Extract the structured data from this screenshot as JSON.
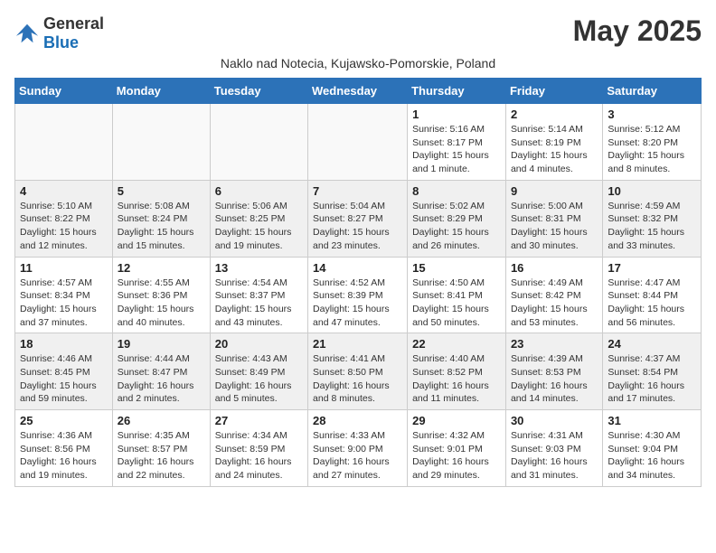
{
  "header": {
    "logo_general": "General",
    "logo_blue": "Blue",
    "title": "May 2025",
    "subtitle": "Naklo nad Notecia, Kujawsko-Pomorskie, Poland"
  },
  "days_of_week": [
    "Sunday",
    "Monday",
    "Tuesday",
    "Wednesday",
    "Thursday",
    "Friday",
    "Saturday"
  ],
  "weeks": [
    [
      {
        "day": "",
        "info": ""
      },
      {
        "day": "",
        "info": ""
      },
      {
        "day": "",
        "info": ""
      },
      {
        "day": "",
        "info": ""
      },
      {
        "day": "1",
        "info": "Sunrise: 5:16 AM\nSunset: 8:17 PM\nDaylight: 15 hours and 1 minute."
      },
      {
        "day": "2",
        "info": "Sunrise: 5:14 AM\nSunset: 8:19 PM\nDaylight: 15 hours and 4 minutes."
      },
      {
        "day": "3",
        "info": "Sunrise: 5:12 AM\nSunset: 8:20 PM\nDaylight: 15 hours and 8 minutes."
      }
    ],
    [
      {
        "day": "4",
        "info": "Sunrise: 5:10 AM\nSunset: 8:22 PM\nDaylight: 15 hours and 12 minutes."
      },
      {
        "day": "5",
        "info": "Sunrise: 5:08 AM\nSunset: 8:24 PM\nDaylight: 15 hours and 15 minutes."
      },
      {
        "day": "6",
        "info": "Sunrise: 5:06 AM\nSunset: 8:25 PM\nDaylight: 15 hours and 19 minutes."
      },
      {
        "day": "7",
        "info": "Sunrise: 5:04 AM\nSunset: 8:27 PM\nDaylight: 15 hours and 23 minutes."
      },
      {
        "day": "8",
        "info": "Sunrise: 5:02 AM\nSunset: 8:29 PM\nDaylight: 15 hours and 26 minutes."
      },
      {
        "day": "9",
        "info": "Sunrise: 5:00 AM\nSunset: 8:31 PM\nDaylight: 15 hours and 30 minutes."
      },
      {
        "day": "10",
        "info": "Sunrise: 4:59 AM\nSunset: 8:32 PM\nDaylight: 15 hours and 33 minutes."
      }
    ],
    [
      {
        "day": "11",
        "info": "Sunrise: 4:57 AM\nSunset: 8:34 PM\nDaylight: 15 hours and 37 minutes."
      },
      {
        "day": "12",
        "info": "Sunrise: 4:55 AM\nSunset: 8:36 PM\nDaylight: 15 hours and 40 minutes."
      },
      {
        "day": "13",
        "info": "Sunrise: 4:54 AM\nSunset: 8:37 PM\nDaylight: 15 hours and 43 minutes."
      },
      {
        "day": "14",
        "info": "Sunrise: 4:52 AM\nSunset: 8:39 PM\nDaylight: 15 hours and 47 minutes."
      },
      {
        "day": "15",
        "info": "Sunrise: 4:50 AM\nSunset: 8:41 PM\nDaylight: 15 hours and 50 minutes."
      },
      {
        "day": "16",
        "info": "Sunrise: 4:49 AM\nSunset: 8:42 PM\nDaylight: 15 hours and 53 minutes."
      },
      {
        "day": "17",
        "info": "Sunrise: 4:47 AM\nSunset: 8:44 PM\nDaylight: 15 hours and 56 minutes."
      }
    ],
    [
      {
        "day": "18",
        "info": "Sunrise: 4:46 AM\nSunset: 8:45 PM\nDaylight: 15 hours and 59 minutes."
      },
      {
        "day": "19",
        "info": "Sunrise: 4:44 AM\nSunset: 8:47 PM\nDaylight: 16 hours and 2 minutes."
      },
      {
        "day": "20",
        "info": "Sunrise: 4:43 AM\nSunset: 8:49 PM\nDaylight: 16 hours and 5 minutes."
      },
      {
        "day": "21",
        "info": "Sunrise: 4:41 AM\nSunset: 8:50 PM\nDaylight: 16 hours and 8 minutes."
      },
      {
        "day": "22",
        "info": "Sunrise: 4:40 AM\nSunset: 8:52 PM\nDaylight: 16 hours and 11 minutes."
      },
      {
        "day": "23",
        "info": "Sunrise: 4:39 AM\nSunset: 8:53 PM\nDaylight: 16 hours and 14 minutes."
      },
      {
        "day": "24",
        "info": "Sunrise: 4:37 AM\nSunset: 8:54 PM\nDaylight: 16 hours and 17 minutes."
      }
    ],
    [
      {
        "day": "25",
        "info": "Sunrise: 4:36 AM\nSunset: 8:56 PM\nDaylight: 16 hours and 19 minutes."
      },
      {
        "day": "26",
        "info": "Sunrise: 4:35 AM\nSunset: 8:57 PM\nDaylight: 16 hours and 22 minutes."
      },
      {
        "day": "27",
        "info": "Sunrise: 4:34 AM\nSunset: 8:59 PM\nDaylight: 16 hours and 24 minutes."
      },
      {
        "day": "28",
        "info": "Sunrise: 4:33 AM\nSunset: 9:00 PM\nDaylight: 16 hours and 27 minutes."
      },
      {
        "day": "29",
        "info": "Sunrise: 4:32 AM\nSunset: 9:01 PM\nDaylight: 16 hours and 29 minutes."
      },
      {
        "day": "30",
        "info": "Sunrise: 4:31 AM\nSunset: 9:03 PM\nDaylight: 16 hours and 31 minutes."
      },
      {
        "day": "31",
        "info": "Sunrise: 4:30 AM\nSunset: 9:04 PM\nDaylight: 16 hours and 34 minutes."
      }
    ]
  ]
}
